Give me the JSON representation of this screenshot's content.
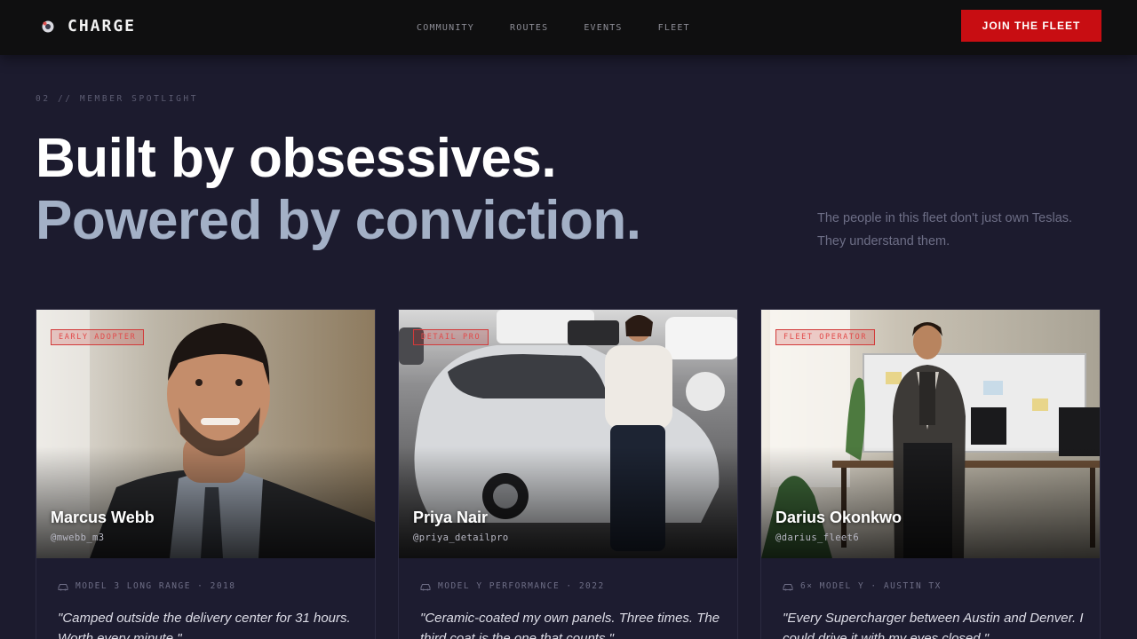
{
  "brand": {
    "name": "CHARGE",
    "icon": "charge-logo-icon"
  },
  "nav": {
    "links": [
      "COMMUNITY",
      "ROUTES",
      "EVENTS",
      "FLEET"
    ],
    "cta_label": "JOIN THE FLEET"
  },
  "section": {
    "eyebrow": "02 // MEMBER SPOTLIGHT",
    "headline_line1": "Built by obsessives.",
    "headline_line2": "Powered by conviction.",
    "lede": "The people in this fleet don't just own Teslas. They understand them."
  },
  "members": [
    {
      "badge": "EARLY ADOPTER",
      "name": "Marcus Webb",
      "handle": "@mwebb_m3",
      "vehicle": "MODEL 3 LONG RANGE · 2018",
      "quote": "\"Camped outside the delivery center for 31 hours. Worth every minute.\""
    },
    {
      "badge": "DETAIL PRO",
      "name": "Priya Nair",
      "handle": "@priya_detailpro",
      "vehicle": "MODEL Y PERFORMANCE · 2022",
      "quote": "\"Ceramic-coated my own panels. Three times. The third coat is the one that counts.\""
    },
    {
      "badge": "FLEET OPERATOR",
      "name": "Darius Okonkwo",
      "handle": "@darius_fleet6",
      "vehicle": "6× MODEL Y · AUSTIN TX",
      "quote": "\"Every Supercharger between Austin and Denver. I could drive it with my eyes closed.\""
    }
  ],
  "colors": {
    "background": "#1c1b2e",
    "nav": "#0f0f10",
    "accent_red": "#c80d12",
    "headline_secondary": "#a3b0c6"
  }
}
